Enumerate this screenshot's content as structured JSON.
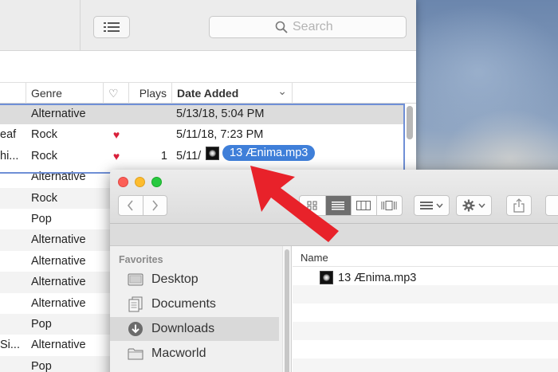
{
  "itunes": {
    "search_placeholder": "Search",
    "columns": {
      "genre": "Genre",
      "heart": "♡",
      "plays": "Plays",
      "date_added": "Date Added",
      "sort_indicator": "⌄"
    },
    "rows": [
      {
        "title": "",
        "genre": "Alternative",
        "heart": "",
        "plays": "",
        "date": "5/13/18, 5:04 PM"
      },
      {
        "title": "eaf",
        "genre": "Rock",
        "heart": "♥",
        "plays": "",
        "date": "5/11/18, 7:23 PM"
      },
      {
        "title": "hi...",
        "genre": "Rock",
        "heart": "♥",
        "plays": "1",
        "date": "5/11/"
      },
      {
        "title": "",
        "genre": "Alternative",
        "heart": "",
        "plays": "",
        "date": ""
      },
      {
        "title": "",
        "genre": "Rock",
        "heart": "",
        "plays": "",
        "date": ""
      },
      {
        "title": "",
        "genre": "Pop",
        "heart": "",
        "plays": "",
        "date": ""
      },
      {
        "title": "",
        "genre": "Alternative",
        "heart": "",
        "plays": "",
        "date": ""
      },
      {
        "title": "",
        "genre": "Alternative",
        "heart": "",
        "plays": "",
        "date": ""
      },
      {
        "title": "",
        "genre": "Alternative",
        "heart": "",
        "plays": "",
        "date": ""
      },
      {
        "title": "",
        "genre": "Alternative",
        "heart": "",
        "plays": "",
        "date": ""
      },
      {
        "title": "",
        "genre": "Pop",
        "heart": "",
        "plays": "",
        "date": ""
      },
      {
        "title": "Si...",
        "genre": "Alternative",
        "heart": "",
        "plays": "",
        "date": ""
      },
      {
        "title": "",
        "genre": "Pop",
        "heart": "",
        "plays": "",
        "date": ""
      }
    ]
  },
  "drag": {
    "label": "13 Ænima.mp3"
  },
  "finder": {
    "favorites_label": "Favorites",
    "sidebar_items": [
      {
        "label": "Desktop",
        "icon": "desktop-icon"
      },
      {
        "label": "Documents",
        "icon": "documents-icon"
      },
      {
        "label": "Downloads",
        "icon": "downloads-icon",
        "selected": true
      },
      {
        "label": "Macworld",
        "icon": "folder-icon"
      }
    ],
    "name_header": "Name",
    "file_name": "13 Ænima.mp3"
  },
  "colors": {
    "selection_outline": "#6f8fd6",
    "heart": "#d9203a",
    "drag_pill": "#3f7fd9",
    "arrow": "#e8222a"
  }
}
